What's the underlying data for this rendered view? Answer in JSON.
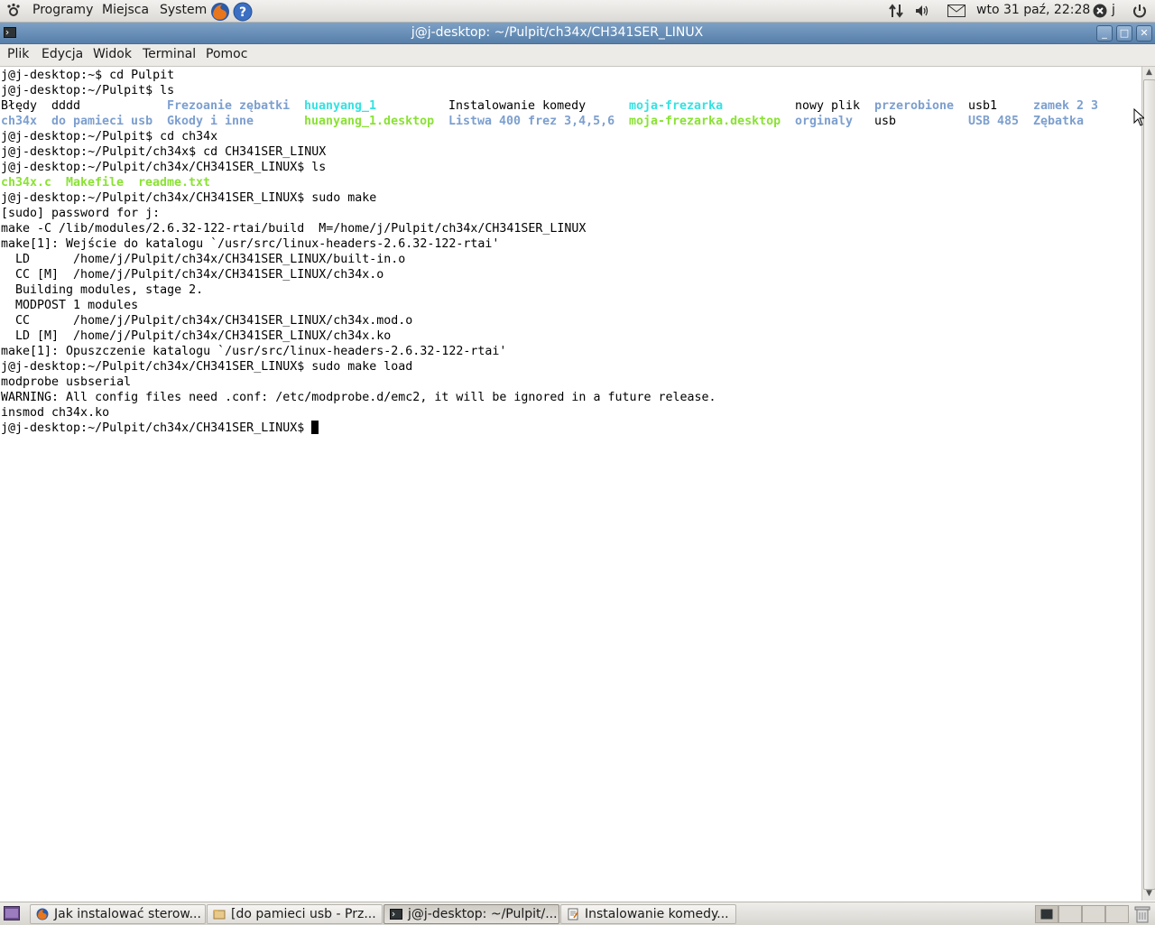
{
  "top_panel": {
    "menus": [
      "Programy",
      "Miejsca",
      "System"
    ],
    "clock": "wto 31 paź, 22:28",
    "user": "j",
    "icons": [
      "gnome-foot-icon",
      "firefox-icon",
      "help-icon",
      "network-icon",
      "volume-icon",
      "mail-icon",
      "user-status-icon",
      "power-icon"
    ]
  },
  "window": {
    "title": "j@j-desktop: ~/Pulpit/ch34x/CH341SER_LINUX",
    "menu": [
      "Plik",
      "Edycja",
      "Widok",
      "Terminal",
      "Pomoc"
    ]
  },
  "terminal": {
    "colors": {
      "directory": "#7c9fcf",
      "executable": "#8ae234",
      "cyan": "#34e2e2",
      "text": "#000000"
    },
    "lines": [
      {
        "t": "j@j-desktop:~$ cd Pulpit"
      },
      {
        "t": "j@j-desktop:~/Pulpit$ ls"
      },
      {
        "segments": [
          {
            "text": "Błędy",
            "col": 0,
            "cls": "norm"
          },
          {
            "text": "dddd",
            "col": 7,
            "cls": "norm"
          },
          {
            "text": "Frezoanie zębatki",
            "col": 23,
            "cls": "dir"
          },
          {
            "text": "huanyang_1",
            "col": 42,
            "cls": "cyan"
          },
          {
            "text": "Instalowanie komedy",
            "col": 62,
            "cls": "norm"
          },
          {
            "text": "moja-frezarka",
            "col": 87,
            "cls": "cyan"
          },
          {
            "text": "nowy plik",
            "col": 110,
            "cls": "norm"
          },
          {
            "text": "przerobione",
            "col": 121,
            "cls": "dir"
          },
          {
            "text": "usb1",
            "col": 134,
            "cls": "norm"
          },
          {
            "text": "zamek 2 3",
            "col": 143,
            "cls": "dir"
          }
        ]
      },
      {
        "segments": [
          {
            "text": "ch34x",
            "col": 0,
            "cls": "dir"
          },
          {
            "text": "do pamieci usb",
            "col": 7,
            "cls": "dir"
          },
          {
            "text": "Gkody i inne",
            "col": 23,
            "cls": "dir"
          },
          {
            "text": "huanyang_1.desktop",
            "col": 42,
            "cls": "exe"
          },
          {
            "text": "Listwa 400 frez 3,4,5,6",
            "col": 62,
            "cls": "dir"
          },
          {
            "text": "moja-frezarka.desktop",
            "col": 87,
            "cls": "exe"
          },
          {
            "text": "orginaly",
            "col": 110,
            "cls": "dir"
          },
          {
            "text": "usb",
            "col": 121,
            "cls": "norm"
          },
          {
            "text": "USB 485",
            "col": 134,
            "cls": "dir"
          },
          {
            "text": "Zębatka",
            "col": 143,
            "cls": "dir"
          }
        ]
      },
      {
        "t": "j@j-desktop:~/Pulpit$ cd ch34x"
      },
      {
        "t": "j@j-desktop:~/Pulpit/ch34x$ cd CH341SER_LINUX"
      },
      {
        "t": "j@j-desktop:~/Pulpit/ch34x/CH341SER_LINUX$ ls"
      },
      {
        "segments": [
          {
            "text": "ch34x.c",
            "col": 0,
            "cls": "exe"
          },
          {
            "text": "Makefile",
            "col": 9,
            "cls": "exe"
          },
          {
            "text": "readme.txt",
            "col": 19,
            "cls": "exe"
          }
        ]
      },
      {
        "t": "j@j-desktop:~/Pulpit/ch34x/CH341SER_LINUX$ sudo make"
      },
      {
        "t": "[sudo] password for j:"
      },
      {
        "t": "make -C /lib/modules/2.6.32-122-rtai/build  M=/home/j/Pulpit/ch34x/CH341SER_LINUX"
      },
      {
        "t": "make[1]: Wejście do katalogu `/usr/src/linux-headers-2.6.32-122-rtai'"
      },
      {
        "t": "  LD      /home/j/Pulpit/ch34x/CH341SER_LINUX/built-in.o"
      },
      {
        "t": "  CC [M]  /home/j/Pulpit/ch34x/CH341SER_LINUX/ch34x.o"
      },
      {
        "t": "  Building modules, stage 2."
      },
      {
        "t": "  MODPOST 1 modules"
      },
      {
        "t": "  CC      /home/j/Pulpit/ch34x/CH341SER_LINUX/ch34x.mod.o"
      },
      {
        "t": "  LD [M]  /home/j/Pulpit/ch34x/CH341SER_LINUX/ch34x.ko"
      },
      {
        "t": "make[1]: Opuszczenie katalogu `/usr/src/linux-headers-2.6.32-122-rtai'"
      },
      {
        "t": "j@j-desktop:~/Pulpit/ch34x/CH341SER_LINUX$ sudo make load"
      },
      {
        "t": "modprobe usbserial"
      },
      {
        "t": "WARNING: All config files need .conf: /etc/modprobe.d/emc2, it will be ignored in a future release."
      },
      {
        "t": "insmod ch34x.ko"
      },
      {
        "t": "j@j-desktop:~/Pulpit/ch34x/CH341SER_LINUX$ ",
        "cursor": true
      }
    ]
  },
  "taskbar": {
    "tasks": [
      {
        "label": "Jak instalować sterow...",
        "icon": "firefox-icon",
        "active": false
      },
      {
        "label": "[do pamieci usb - Prz...",
        "icon": "folder-icon",
        "active": false
      },
      {
        "label": "j@j-desktop: ~/Pulpit/...",
        "icon": "terminal-icon",
        "active": true
      },
      {
        "label": "Instalowanie komedy...",
        "icon": "text-editor-icon",
        "active": false
      }
    ],
    "workspaces": 4
  }
}
